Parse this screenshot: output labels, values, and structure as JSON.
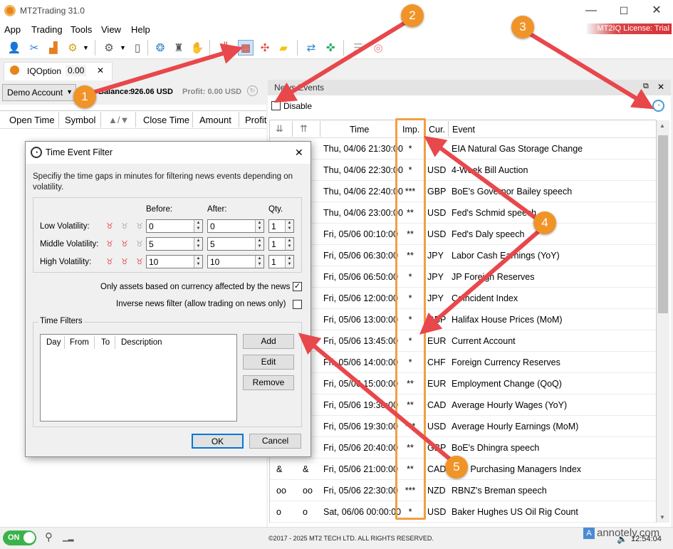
{
  "window": {
    "title": "MT2Trading 31.0",
    "minimize": "—",
    "maximize": "☐",
    "close": "✕"
  },
  "menu": [
    "App",
    "Trading",
    "Tools",
    "View",
    "Help"
  ],
  "license": "MT2IQ License: Trial",
  "toolbar_icons": [
    "add-user-icon",
    "tools-icon",
    "chart-icon",
    "coin-settings-icon",
    "gear-icon",
    "phone-icon",
    "brain-icon",
    "spy-icon",
    "hand-icon",
    "candles-icon",
    "news-calendar-icon",
    "network-icon",
    "chat-icon",
    "sync-icon",
    "shuffle-icon",
    "list-icon",
    "eye-off-icon"
  ],
  "tab": {
    "name": "IQOption",
    "value": "0.00",
    "close": "✕"
  },
  "account": {
    "type": "Demo Account",
    "balance_label": "Balance:",
    "balance": "926.06 USD",
    "profit": "Profit: 0.00 USD"
  },
  "orders_columns": [
    "Open Time",
    "Symbol",
    "▲/▼",
    "Close Time",
    "Amount",
    "Profit"
  ],
  "news_panel": {
    "title": "News Events",
    "disable_label": "Disable"
  },
  "news_columns": [
    "Time",
    "Imp.",
    "Cur.",
    "Event"
  ],
  "news_rows": [
    {
      "i1": "",
      "i2": "",
      "time": "Thu, 04/06 21:30:00",
      "imp": "*",
      "cur": "",
      "event": "EIA Natural Gas Storage Change"
    },
    {
      "i1": "",
      "i2": "",
      "time": "Thu, 04/06 22:30:00",
      "imp": "*",
      "cur": "USD",
      "event": "4-Week Bill Auction"
    },
    {
      "i1": "",
      "i2": "",
      "time": "Thu, 04/06 22:40:00",
      "imp": "***",
      "cur": "GBP",
      "event": "BoE's Governor Bailey speech"
    },
    {
      "i1": "",
      "i2": "",
      "time": "Thu, 04/06 23:00:00",
      "imp": "**",
      "cur": "USD",
      "event": "Fed's Schmid speech"
    },
    {
      "i1": "",
      "i2": "",
      "time": "Fri, 05/06 00:10:00",
      "imp": "**",
      "cur": "USD",
      "event": "Fed's Daly speech"
    },
    {
      "i1": "",
      "i2": "",
      "time": "Fri, 05/06 06:30:00",
      "imp": "**",
      "cur": "JPY",
      "event": "Labor Cash Earnings (YoY)"
    },
    {
      "i1": "",
      "i2": "",
      "time": "Fri, 05/06 06:50:00",
      "imp": "*",
      "cur": "JPY",
      "event": "JP Foreign Reserves"
    },
    {
      "i1": "",
      "i2": "",
      "time": "Fri, 05/06 12:00:00",
      "imp": "*",
      "cur": "JPY",
      "event": "Coincident Index"
    },
    {
      "i1": "",
      "i2": "",
      "time": "Fri, 05/06 13:00:00",
      "imp": "*",
      "cur": "GBP",
      "event": "Halifax House Prices (MoM)"
    },
    {
      "i1": "",
      "i2": "",
      "time": "Fri, 05/06 13:45:00",
      "imp": "*",
      "cur": "EUR",
      "event": "Current Account"
    },
    {
      "i1": "",
      "i2": "",
      "time": "Fri, 05/06 14:00:00",
      "imp": "*",
      "cur": "CHF",
      "event": "Foreign Currency Reserves"
    },
    {
      "i1": "",
      "i2": "",
      "time": "Fri, 05/06 15:00:00",
      "imp": "**",
      "cur": "EUR",
      "event": "Employment Change (QoQ)"
    },
    {
      "i1": "",
      "i2": "",
      "time": "Fri, 05/06 19:30:00",
      "imp": "**",
      "cur": "CAD",
      "event": "Average Hourly Wages (YoY)"
    },
    {
      "i1": "",
      "i2": "",
      "time": "Fri, 05/06 19:30:00",
      "imp": "***",
      "cur": "USD",
      "event": "Average Hourly Earnings (MoM)"
    },
    {
      "i1": "",
      "i2": "",
      "time": "Fri, 05/06 20:40:00",
      "imp": "**",
      "cur": "GBP",
      "event": "BoE's Dhingra speech"
    },
    {
      "i1": "&",
      "i2": "&",
      "time": "Fri, 05/06 21:00:00",
      "imp": "**",
      "cur": "CAD",
      "event": "Ivey Purchasing Managers Index"
    },
    {
      "i1": "oo",
      "i2": "oo",
      "time": "Fri, 05/06 22:30:00",
      "imp": "***",
      "cur": "NZD",
      "event": "RBNZ's Breman speech"
    },
    {
      "i1": "o",
      "i2": "o",
      "time": "Sat, 06/06 00:00:00",
      "imp": "*",
      "cur": "USD",
      "event": "Baker Hughes US Oil Rig Count"
    }
  ],
  "dialog": {
    "title": "Time Event Filter",
    "close": "✕",
    "description": "Specifiy the time gaps in minutes for filtering news events depending on volatility.",
    "col_before": "Before:",
    "col_after": "After:",
    "col_qty": "Qty.",
    "rows": [
      {
        "label": "Low Volatility:",
        "before": "0",
        "after": "0",
        "qty": "1"
      },
      {
        "label": "Middle Volatility:",
        "before": "5",
        "after": "5",
        "qty": "1"
      },
      {
        "label": "High Volatility:",
        "before": "10",
        "after": "10",
        "qty": "1"
      }
    ],
    "only_assets_label": "Only assets based on currency affected by the news",
    "inverse_label": "Inverse news filter (allow trading on news only)",
    "time_filters_title": "Time Filters",
    "time_filter_columns": [
      "Day",
      "From",
      "To",
      "Description"
    ],
    "add": "Add",
    "edit": "Edit",
    "remove": "Remove",
    "ok": "OK",
    "cancel": "Cancel"
  },
  "status": {
    "toggle": "ON",
    "copyright": "©2017 - 2025 MT2 TECH LTD. ALL RIGHTS RESERVED.",
    "watermark": "annotely.com",
    "clock": "12:54:04"
  },
  "markers": [
    "1",
    "2",
    "3",
    "4",
    "5"
  ],
  "colors": {
    "accent_orange": "#f09428",
    "arrow_red": "#e8474b",
    "license_red": "#d83236",
    "toggle_green": "#3bb34a",
    "selection_blue": "#0078d7"
  }
}
